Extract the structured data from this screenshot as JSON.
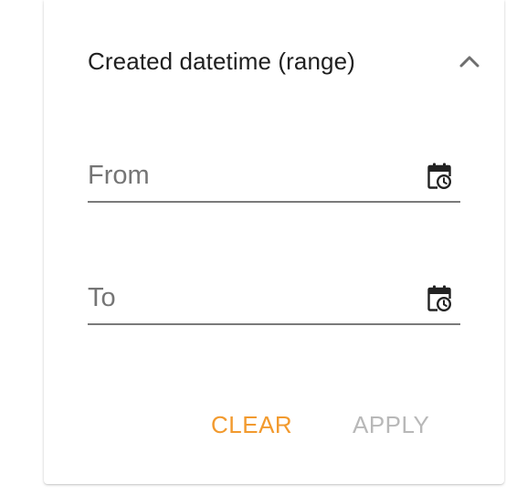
{
  "filter": {
    "title": "Created datetime (range)",
    "expanded": true,
    "toggle_icon": "chevron-up-icon"
  },
  "fields": {
    "from": {
      "placeholder": "From",
      "value": "",
      "icon": "calendar-clock-icon"
    },
    "to": {
      "placeholder": "To",
      "value": "",
      "icon": "calendar-clock-icon"
    }
  },
  "actions": {
    "clear_label": "CLEAR",
    "apply_label": "APPLY",
    "apply_enabled": false
  },
  "colors": {
    "accent": "#f29a2e",
    "disabled": "#b8b8b8",
    "text": "#1f1f1f",
    "placeholder": "#757575",
    "underline": "#7a7a7a"
  }
}
